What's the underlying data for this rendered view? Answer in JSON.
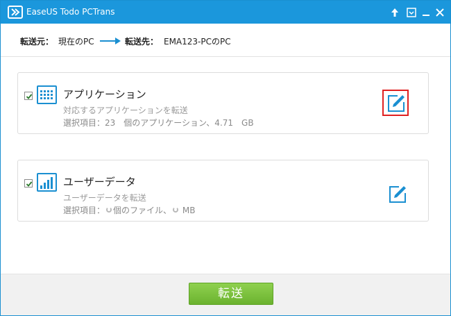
{
  "window": {
    "title": "EaseUS Todo PCTrans"
  },
  "route": {
    "from_label": "転送元：",
    "from_value": "現在のPC",
    "to_label": "転送先：",
    "to_value": "EMA123-PCのPC"
  },
  "categories": [
    {
      "title": "アプリケーション",
      "description": "対応するアプリケーションを転送",
      "selection": "選択項目：23　個のアプリケーション、4.71　GB",
      "checked": true,
      "icon": "apps-grid-icon"
    },
    {
      "title": "ユーザーデータ",
      "description": "ユーザーデータを転送",
      "selection_prefix": "選択項目：",
      "selection_mid": "個のファイル、",
      "selection_suffix": "MB",
      "checked": true,
      "icon": "bar-chart-icon"
    }
  ],
  "footer": {
    "transfer_label": "転送"
  },
  "colors": {
    "titlebar": "#1b97dc",
    "accent": "#1a8fd1",
    "button": "#7cc13f",
    "highlight": "#e02020"
  }
}
